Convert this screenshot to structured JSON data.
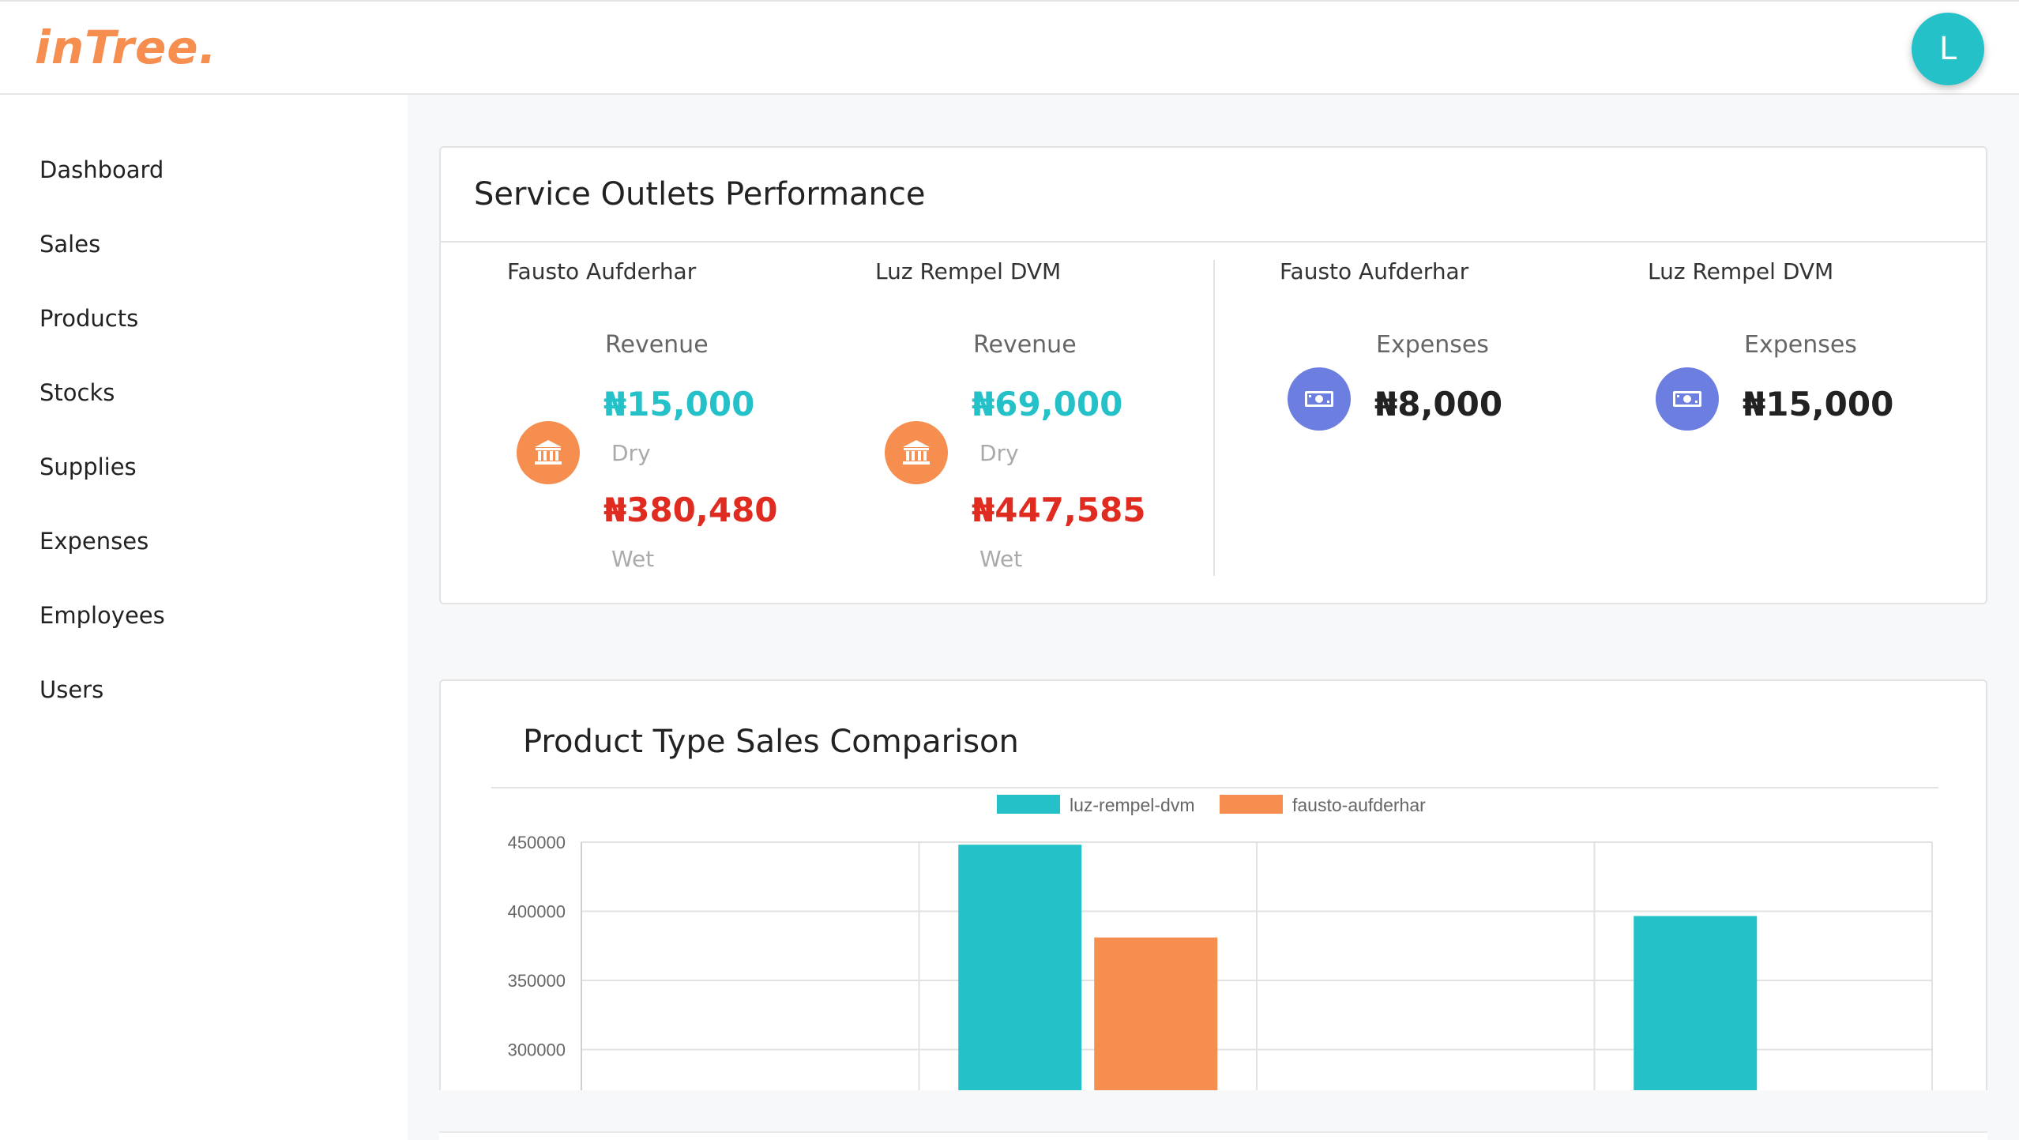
{
  "app": {
    "logo": "inTree.",
    "avatar_initial": "L"
  },
  "sidebar": {
    "items": [
      {
        "label": "Dashboard"
      },
      {
        "label": "Sales"
      },
      {
        "label": "Products"
      },
      {
        "label": "Stocks"
      },
      {
        "label": "Supplies"
      },
      {
        "label": "Expenses"
      },
      {
        "label": "Employees"
      },
      {
        "label": "Users"
      }
    ]
  },
  "outlets_card": {
    "title": "Service Outlets Performance",
    "revenue": [
      {
        "name": "Fausto Aufderhar",
        "label": "Revenue",
        "dry_value": "₦15,000",
        "dry_label": "Dry",
        "wet_value": "₦380,480",
        "wet_label": "Wet",
        "icon": "bank-icon"
      },
      {
        "name": "Luz Rempel DVM",
        "label": "Revenue",
        "dry_value": "₦69,000",
        "dry_label": "Dry",
        "wet_value": "₦447,585",
        "wet_label": "Wet",
        "icon": "bank-icon"
      }
    ],
    "expenses": [
      {
        "name": "Fausto Aufderhar",
        "label": "Expenses",
        "value": "₦8,000",
        "icon": "money-bill-icon"
      },
      {
        "name": "Luz Rempel DVM",
        "label": "Expenses",
        "value": "₦15,000",
        "icon": "money-bill-icon"
      }
    ],
    "colors": {
      "teal": "#25c1c8",
      "red": "#e02b20",
      "orange": "#f58e4f",
      "purple": "#6c7ee0"
    }
  },
  "sales_card": {
    "title": "Product Type Sales Comparison"
  },
  "chart_data": {
    "type": "bar",
    "categories": [
      "",
      "",
      "",
      ""
    ],
    "series": [
      {
        "name": "luz-rempel-dvm",
        "color": "#25c1c8",
        "values": [
          null,
          447585,
          null,
          396000
        ]
      },
      {
        "name": "fausto-aufderhar",
        "color": "#f58e4f",
        "values": [
          null,
          380480,
          null,
          null
        ]
      }
    ],
    "y_ticks": [
      "450000",
      "400000",
      "350000",
      "300000"
    ],
    "ylim": [
      300000,
      450000
    ],
    "legend_position": "top",
    "grid": true
  }
}
